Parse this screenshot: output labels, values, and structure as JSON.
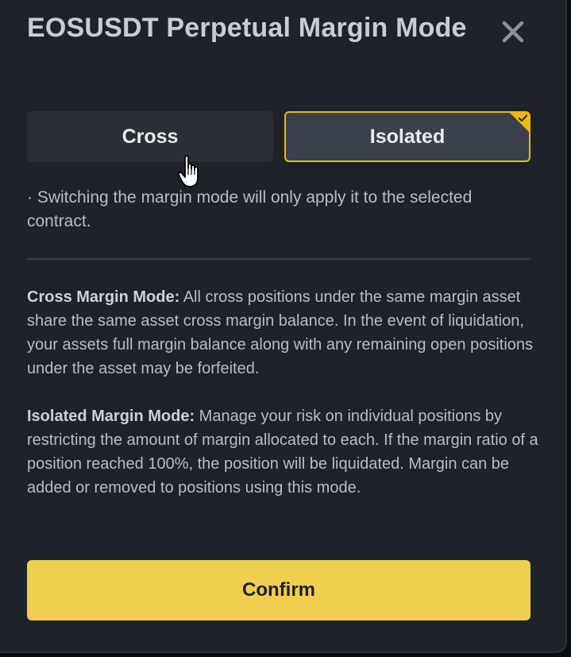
{
  "dialog": {
    "title": "EOSUSDT Perpetual Margin Mode"
  },
  "mode_toggle": {
    "cross_label": "Cross",
    "isolated_label": "Isolated",
    "selected": "Isolated"
  },
  "note": "· Switching the margin mode will only apply it to the selected contract.",
  "descriptions": {
    "cross": {
      "heading": "Cross Margin Mode:",
      "text": " All cross positions under the same margin asset share the same asset cross margin balance. In the event of liquidation, your assets full margin balance along with any remaining open positions under the asset may be forfeited."
    },
    "isolated": {
      "heading": "Isolated Margin Mode:",
      "text": " Manage your risk on individual positions by restricting the amount of margin allocated to each. If the margin ratio of a position reached 100%, the position will be liquidated. Margin can be added or removed to positions using this mode."
    }
  },
  "confirm_label": "Confirm",
  "icons": {
    "close": "close-icon",
    "check": "check-icon",
    "cursor": "hand-pointer-cursor"
  },
  "colors": {
    "accent": "#f0b90b",
    "confirm_bg": "#f0ce4e",
    "panel_bg": "#1f2329"
  }
}
